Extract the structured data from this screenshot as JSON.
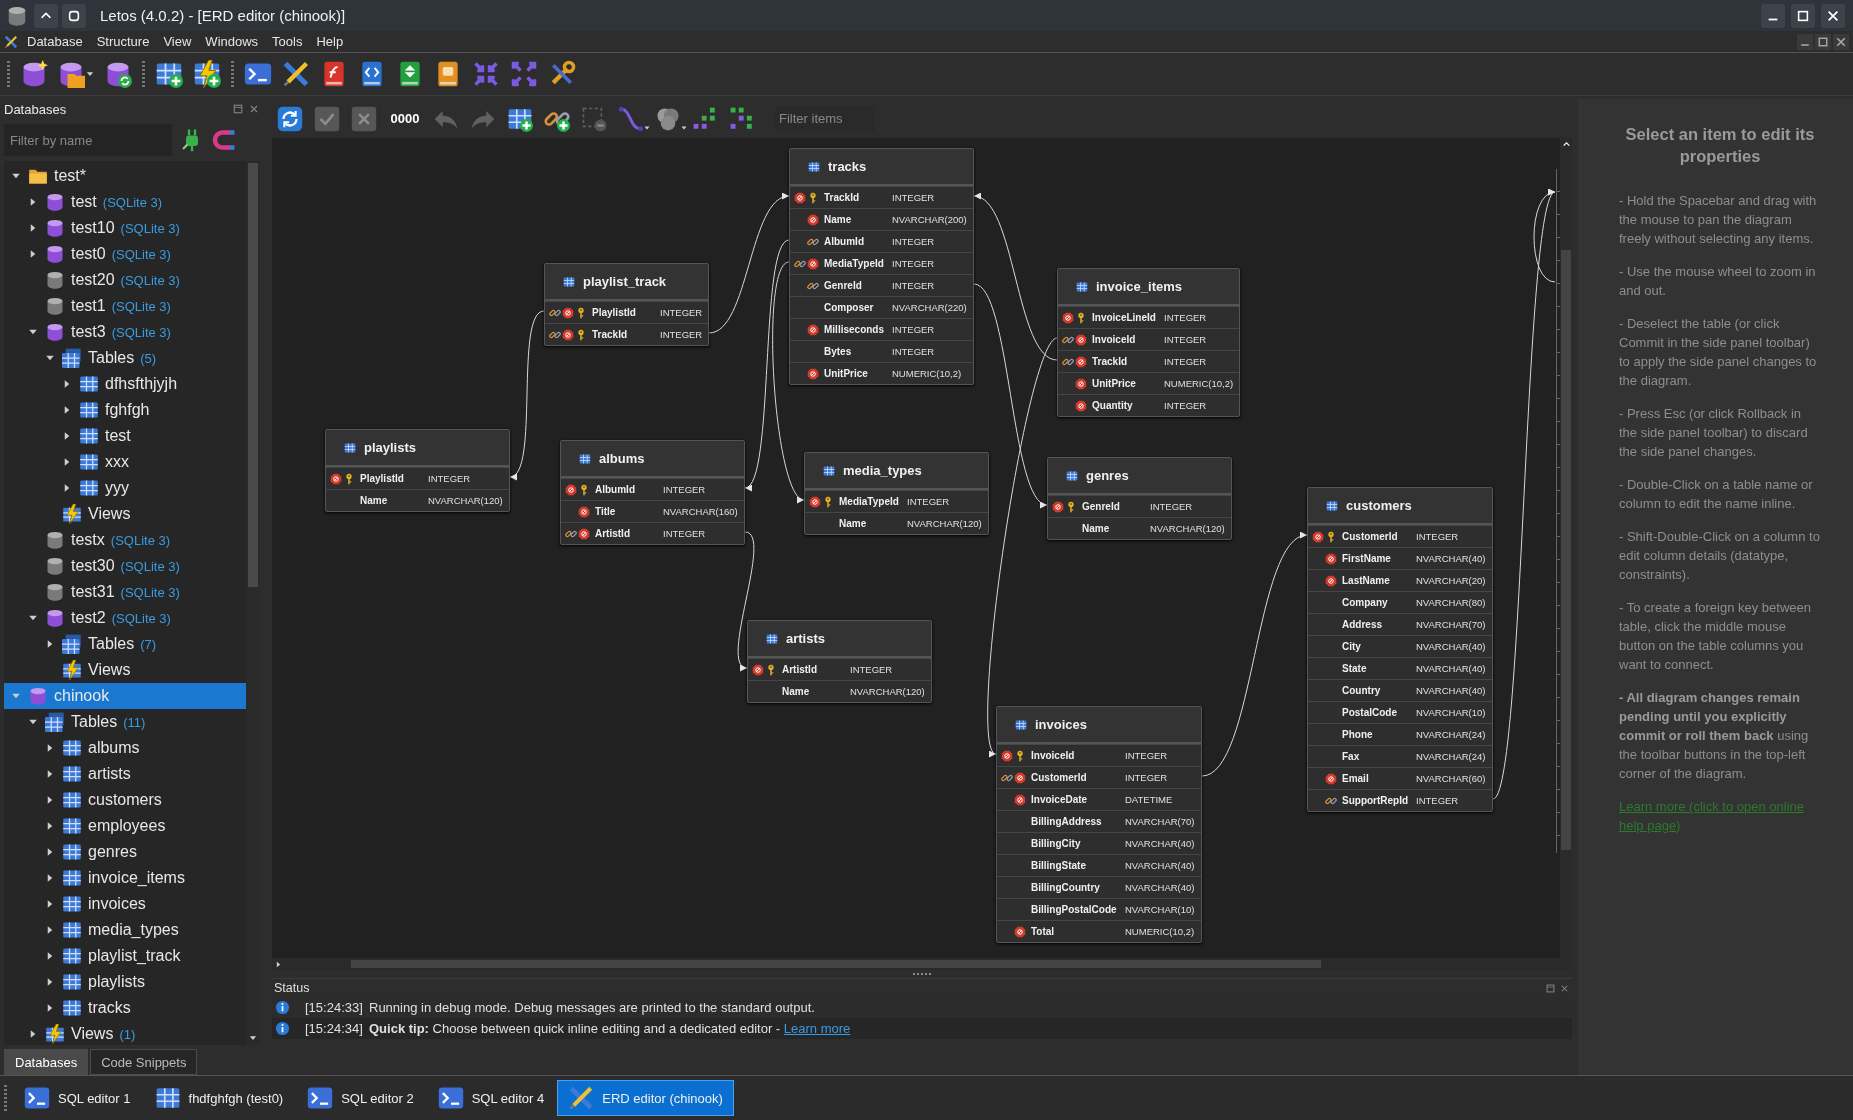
{
  "window": {
    "title": "Letos (4.0.2) - [ERD editor (chinook)]"
  },
  "menu": [
    "Database",
    "Structure",
    "View",
    "Windows",
    "Tools",
    "Help"
  ],
  "toolbar": [
    {
      "kind": "separator"
    },
    {
      "kind": "db-add"
    },
    {
      "kind": "db-open"
    },
    {
      "kind": "db-refresh"
    },
    {
      "kind": "separator"
    },
    {
      "kind": "table-add"
    },
    {
      "kind": "table-flash"
    },
    {
      "kind": "separator"
    },
    {
      "kind": "terminal"
    },
    {
      "kind": "erd"
    },
    {
      "kind": "function"
    },
    {
      "kind": "code"
    },
    {
      "kind": "import"
    },
    {
      "kind": "export"
    },
    {
      "kind": "collapse"
    },
    {
      "kind": "expand"
    },
    {
      "kind": "tools"
    }
  ],
  "databases_panel": {
    "title": "Databases",
    "filter": {
      "placeholder": "Filter by name"
    },
    "tree": [
      {
        "label": "test*",
        "kind": "folder",
        "expanded": true,
        "selected": false,
        "children": [
          {
            "label": "test",
            "note": "(SQLite 3)",
            "kind": "db",
            "expanded": false,
            "selected": false
          },
          {
            "label": "test10",
            "note": "(SQLite 3)",
            "kind": "db",
            "expanded": false,
            "selected": false
          },
          {
            "label": "test0",
            "note": "(SQLite 3)",
            "kind": "db",
            "expanded": false,
            "selected": false
          },
          {
            "label": "test20",
            "note": "(SQLite 3)",
            "kind": "db_off",
            "selected": false
          },
          {
            "label": "test1",
            "note": "(SQLite 3)",
            "kind": "db_off",
            "selected": false
          },
          {
            "label": "test3",
            "note": "(SQLite 3)",
            "kind": "db",
            "expanded": true,
            "selected": false,
            "children": [
              {
                "label": "Tables",
                "note": "(5)",
                "kind": "tables",
                "expanded": true,
                "selected": false,
                "children": [
                  {
                    "label": "dfhsfthjyjh",
                    "kind": "table",
                    "expanded": false,
                    "selected": false
                  },
                  {
                    "label": "fghfgh",
                    "kind": "table",
                    "expanded": false,
                    "selected": false
                  },
                  {
                    "label": "test",
                    "kind": "table",
                    "expanded": false,
                    "selected": false
                  },
                  {
                    "label": "xxx",
                    "kind": "table",
                    "expanded": false,
                    "selected": false
                  },
                  {
                    "label": "yyy",
                    "kind": "table",
                    "expanded": false,
                    "selected": false
                  }
                ]
              },
              {
                "label": "Views",
                "kind": "views",
                "selected": false
              }
            ]
          },
          {
            "label": "testx",
            "note": "(SQLite 3)",
            "kind": "db_off",
            "selected": false
          },
          {
            "label": "test30",
            "note": "(SQLite 3)",
            "kind": "db_off",
            "selected": false
          },
          {
            "label": "test31",
            "note": "(SQLite 3)",
            "kind": "db_off",
            "selected": false
          },
          {
            "label": "test2",
            "note": "(SQLite 3)",
            "kind": "db",
            "expanded": true,
            "selected": false,
            "children": [
              {
                "label": "Tables",
                "note": "(7)",
                "kind": "tables",
                "expanded": false,
                "selected": false
              },
              {
                "label": "Views",
                "kind": "views",
                "selected": false
              }
            ]
          }
        ]
      },
      {
        "label": "chinook",
        "kind": "db",
        "expanded": true,
        "selected": true,
        "children": [
          {
            "label": "Tables",
            "note": "(11)",
            "kind": "tables",
            "expanded": true,
            "selected": false,
            "children": [
              {
                "label": "albums",
                "kind": "table",
                "expanded": false,
                "selected": false
              },
              {
                "label": "artists",
                "kind": "table",
                "expanded": false,
                "selected": false
              },
              {
                "label": "customers",
                "kind": "table",
                "expanded": false,
                "selected": false
              },
              {
                "label": "employees",
                "kind": "table",
                "expanded": false,
                "selected": false
              },
              {
                "label": "genres",
                "kind": "table",
                "expanded": false,
                "selected": false
              },
              {
                "label": "invoice_items",
                "kind": "table",
                "expanded": false,
                "selected": false
              },
              {
                "label": "invoices",
                "kind": "table",
                "expanded": false,
                "selected": false
              },
              {
                "label": "media_types",
                "kind": "table",
                "expanded": false,
                "selected": false
              },
              {
                "label": "playlist_track",
                "kind": "table",
                "expanded": false,
                "selected": false
              },
              {
                "label": "playlists",
                "kind": "table",
                "expanded": false,
                "selected": false
              },
              {
                "label": "tracks",
                "kind": "table",
                "expanded": false,
                "selected": false
              }
            ]
          },
          {
            "label": "Views",
            "note": "(1)",
            "kind": "views",
            "expanded": false,
            "selected": false
          }
        ]
      }
    ],
    "tabs": [
      {
        "label": "Databases",
        "selected": true
      },
      {
        "label": "Code Snippets",
        "selected": false
      }
    ]
  },
  "erd_toolbar": {
    "buttons": [
      {
        "kind": "refresh",
        "disabled": false
      },
      {
        "kind": "commit",
        "disabled": true
      },
      {
        "kind": "rollback",
        "disabled": true
      },
      {
        "kind": "counter",
        "label": "0000",
        "disabled": false
      },
      {
        "kind": "undo",
        "disabled": true
      },
      {
        "kind": "redo",
        "disabled": true
      },
      {
        "kind": "table-add",
        "disabled": false
      },
      {
        "kind": "relation-add",
        "disabled": false
      },
      {
        "kind": "delete",
        "disabled": true
      },
      {
        "kind": "line-style",
        "disabled": false
      },
      {
        "kind": "color",
        "disabled": false
      },
      {
        "kind": "arrange",
        "disabled": false
      },
      {
        "kind": "arrange-alt",
        "disabled": false
      }
    ],
    "filter": {
      "placeholder": "Filter items"
    }
  },
  "diagram": {
    "tables": [
      {
        "name": "tracks",
        "columns": [
          {
            "name": "TrackId",
            "type": "INTEGER",
            "fk": false,
            "not_null": true,
            "pk": true
          },
          {
            "name": "Name",
            "type": "NVARCHAR(200)",
            "fk": false,
            "not_null": true,
            "pk": false
          },
          {
            "name": "AlbumId",
            "type": "INTEGER",
            "fk": true,
            "not_null": false,
            "pk": false
          },
          {
            "name": "MediaTypeId",
            "type": "INTEGER",
            "fk": true,
            "not_null": true,
            "pk": false
          },
          {
            "name": "GenreId",
            "type": "INTEGER",
            "fk": true,
            "not_null": false,
            "pk": false
          },
          {
            "name": "Composer",
            "type": "NVARCHAR(220)",
            "fk": false,
            "not_null": false,
            "pk": false
          },
          {
            "name": "Milliseconds",
            "type": "INTEGER",
            "fk": false,
            "not_null": true,
            "pk": false
          },
          {
            "name": "Bytes",
            "type": "INTEGER",
            "fk": false,
            "not_null": false,
            "pk": false
          },
          {
            "name": "UnitPrice",
            "type": "NUMERIC(10,2)",
            "fk": false,
            "not_null": true,
            "pk": false
          }
        ]
      },
      {
        "name": "playlist_track",
        "columns": [
          {
            "name": "PlaylistId",
            "type": "INTEGER",
            "fk": true,
            "not_null": true,
            "pk": true
          },
          {
            "name": "TrackId",
            "type": "INTEGER",
            "fk": true,
            "not_null": true,
            "pk": true
          }
        ]
      },
      {
        "name": "invoice_items",
        "columns": [
          {
            "name": "InvoiceLineId",
            "type": "INTEGER",
            "fk": false,
            "not_null": true,
            "pk": true
          },
          {
            "name": "InvoiceId",
            "type": "INTEGER",
            "fk": true,
            "not_null": true,
            "pk": false
          },
          {
            "name": "TrackId",
            "type": "INTEGER",
            "fk": true,
            "not_null": true,
            "pk": false
          },
          {
            "name": "UnitPrice",
            "type": "NUMERIC(10,2)",
            "fk": false,
            "not_null": true,
            "pk": false
          },
          {
            "name": "Quantity",
            "type": "INTEGER",
            "fk": false,
            "not_null": true,
            "pk": false
          }
        ]
      },
      {
        "name": "playlists",
        "columns": [
          {
            "name": "PlaylistId",
            "type": "INTEGER",
            "fk": false,
            "not_null": true,
            "pk": true
          },
          {
            "name": "Name",
            "type": "NVARCHAR(120)",
            "fk": false,
            "not_null": false,
            "pk": false
          }
        ]
      },
      {
        "name": "albums",
        "columns": [
          {
            "name": "AlbumId",
            "type": "INTEGER",
            "fk": false,
            "not_null": true,
            "pk": true
          },
          {
            "name": "Title",
            "type": "NVARCHAR(160)",
            "fk": false,
            "not_null": true,
            "pk": false
          },
          {
            "name": "ArtistId",
            "type": "INTEGER",
            "fk": true,
            "not_null": true,
            "pk": false
          }
        ]
      },
      {
        "name": "media_types",
        "columns": [
          {
            "name": "MediaTypeId",
            "type": "INTEGER",
            "fk": false,
            "not_null": true,
            "pk": true
          },
          {
            "name": "Name",
            "type": "NVARCHAR(120)",
            "fk": false,
            "not_null": false,
            "pk": false
          }
        ]
      },
      {
        "name": "genres",
        "columns": [
          {
            "name": "GenreId",
            "type": "INTEGER",
            "fk": false,
            "not_null": true,
            "pk": true
          },
          {
            "name": "Name",
            "type": "NVARCHAR(120)",
            "fk": false,
            "not_null": false,
            "pk": false
          }
        ]
      },
      {
        "name": "customers",
        "columns": [
          {
            "name": "CustomerId",
            "type": "INTEGER",
            "fk": false,
            "not_null": true,
            "pk": true
          },
          {
            "name": "FirstName",
            "type": "NVARCHAR(40)",
            "fk": false,
            "not_null": true,
            "pk": false
          },
          {
            "name": "LastName",
            "type": "NVARCHAR(20)",
            "fk": false,
            "not_null": true,
            "pk": false
          },
          {
            "name": "Company",
            "type": "NVARCHAR(80)",
            "fk": false,
            "not_null": false,
            "pk": false
          },
          {
            "name": "Address",
            "type": "NVARCHAR(70)",
            "fk": false,
            "not_null": false,
            "pk": false
          },
          {
            "name": "City",
            "type": "NVARCHAR(40)",
            "fk": false,
            "not_null": false,
            "pk": false
          },
          {
            "name": "State",
            "type": "NVARCHAR(40)",
            "fk": false,
            "not_null": false,
            "pk": false
          },
          {
            "name": "Country",
            "type": "NVARCHAR(40)",
            "fk": false,
            "not_null": false,
            "pk": false
          },
          {
            "name": "PostalCode",
            "type": "NVARCHAR(10)",
            "fk": false,
            "not_null": false,
            "pk": false
          },
          {
            "name": "Phone",
            "type": "NVARCHAR(24)",
            "fk": false,
            "not_null": false,
            "pk": false
          },
          {
            "name": "Fax",
            "type": "NVARCHAR(24)",
            "fk": false,
            "not_null": false,
            "pk": false
          },
          {
            "name": "Email",
            "type": "NVARCHAR(60)",
            "fk": false,
            "not_null": true,
            "pk": false
          },
          {
            "name": "SupportRepId",
            "type": "INTEGER",
            "fk": true,
            "not_null": false,
            "pk": false
          }
        ]
      },
      {
        "name": "artists",
        "columns": [
          {
            "name": "ArtistId",
            "type": "INTEGER",
            "fk": false,
            "not_null": true,
            "pk": true
          },
          {
            "name": "Name",
            "type": "NVARCHAR(120)",
            "fk": false,
            "not_null": false,
            "pk": false
          }
        ]
      },
      {
        "name": "invoices",
        "columns": [
          {
            "name": "InvoiceId",
            "type": "INTEGER",
            "fk": false,
            "not_null": true,
            "pk": true
          },
          {
            "name": "CustomerId",
            "type": "INTEGER",
            "fk": true,
            "not_null": true,
            "pk": false
          },
          {
            "name": "InvoiceDate",
            "type": "DATETIME",
            "fk": false,
            "not_null": true,
            "pk": false
          },
          {
            "name": "BillingAddress",
            "type": "NVARCHAR(70)",
            "fk": false,
            "not_null": false,
            "pk": false
          },
          {
            "name": "BillingCity",
            "type": "NVARCHAR(40)",
            "fk": false,
            "not_null": false,
            "pk": false
          },
          {
            "name": "BillingState",
            "type": "NVARCHAR(40)",
            "fk": false,
            "not_null": false,
            "pk": false
          },
          {
            "name": "BillingCountry",
            "type": "NVARCHAR(40)",
            "fk": false,
            "not_null": false,
            "pk": false
          },
          {
            "name": "BillingPostalCode",
            "type": "NVARCHAR(10)",
            "fk": false,
            "not_null": false,
            "pk": false
          },
          {
            "name": "Total",
            "type": "NUMERIC(10,2)",
            "fk": false,
            "not_null": true,
            "pk": false
          }
        ]
      }
    ]
  },
  "properties_panel": {
    "heading": "Select an item to edit its properties",
    "paragraphs": [
      "- Hold the Spacebar and drag with the mouse to pan the diagram freely without selecting any items.",
      "- Use the mouse wheel to zoom in and out.",
      "- Deselect the table (or click Commit in the side panel toolbar) to apply the side panel changes to the diagram.",
      "- Press Esc (or click Rollback in the side panel toolbar) to discard the side panel changes.",
      "- Double-Click on a table name or column to edit the name inline.",
      "- Shift-Double-Click on a column to edit column details (datatype, constraints).",
      "- To create a foreign key between table, click the middle mouse button on the table columns you want to connect.",
      "**- All diagram changes remain pending until you explicitly commit or roll them back** using the toolbar buttons in the top-left corner of the diagram."
    ],
    "link": "Learn more (click to open online help page)"
  },
  "status": {
    "title": "Status",
    "messages": [
      {
        "time": "[15:24:33]",
        "text": "Running in debug mode. Debug messages are printed to the standard output."
      },
      {
        "time": "[15:24:34]",
        "text": "**Quick tip:** Choose between quick inline editing and a dedicated editor -",
        "link": "Learn more"
      }
    ]
  },
  "taskbar": [
    {
      "label": "SQL editor 1",
      "kind": "sql",
      "selected": false
    },
    {
      "label": "fhdfghfgh (test0)",
      "kind": "table",
      "selected": false
    },
    {
      "label": "SQL editor 2",
      "kind": "sql",
      "selected": false
    },
    {
      "label": "SQL editor 4",
      "kind": "sql",
      "selected": false
    },
    {
      "label": "ERD editor (chinook)",
      "kind": "erd",
      "selected": true
    }
  ]
}
